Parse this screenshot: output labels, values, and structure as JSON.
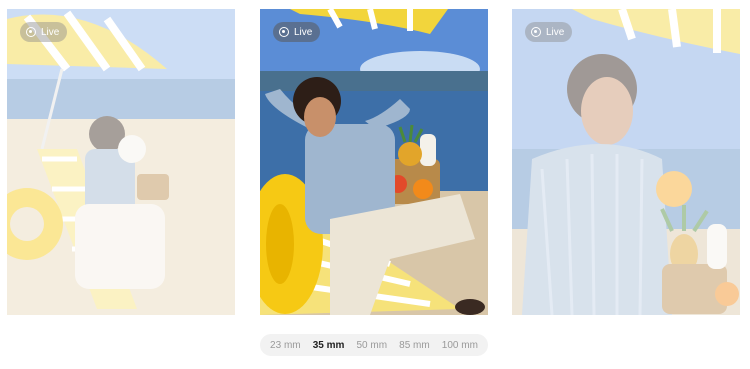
{
  "cards": [
    {
      "live_label": "Live"
    },
    {
      "live_label": "Live"
    },
    {
      "live_label": "Live"
    }
  ],
  "focal_lengths": {
    "options": [
      "23 mm",
      "35 mm",
      "50 mm",
      "85 mm",
      "100 mm"
    ],
    "selected": "35 mm"
  },
  "colors": {
    "umbrella_yellow": "#f2d53c",
    "ring_yellow": "#f6c914",
    "sky_blue": "#5b8dd6",
    "sea_blue": "#3d6fa8",
    "sand": "#d8c6a8"
  }
}
